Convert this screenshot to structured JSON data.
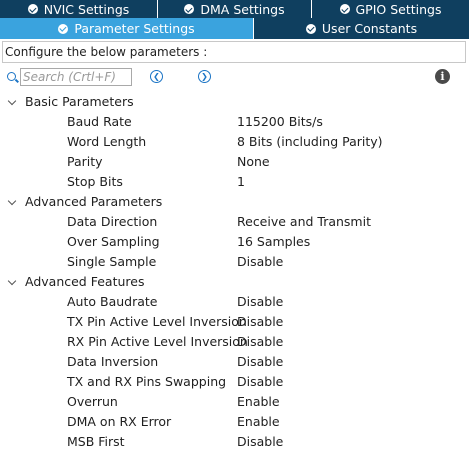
{
  "tabs": {
    "top": [
      {
        "label": "NVIC Settings"
      },
      {
        "label": "DMA Settings"
      },
      {
        "label": "GPIO Settings"
      }
    ],
    "bottom": [
      {
        "label": "Parameter Settings"
      },
      {
        "label": "User Constants"
      }
    ]
  },
  "configure_text": "Configure the below parameters :",
  "search": {
    "placeholder": "Search (Crtl+F)"
  },
  "colors": {
    "tab_dark": "#0f3f5f",
    "tab_active": "#3aa3de",
    "accent_blue": "#1b74c5"
  },
  "groups": [
    {
      "label": "Basic Parameters",
      "params": [
        {
          "name": "Baud Rate",
          "value": "115200 Bits/s"
        },
        {
          "name": "Word Length",
          "value": "8 Bits (including Parity)"
        },
        {
          "name": "Parity",
          "value": "None"
        },
        {
          "name": "Stop Bits",
          "value": "1"
        }
      ]
    },
    {
      "label": "Advanced Parameters",
      "params": [
        {
          "name": "Data Direction",
          "value": "Receive and Transmit"
        },
        {
          "name": "Over Sampling",
          "value": "16 Samples"
        },
        {
          "name": "Single Sample",
          "value": "Disable"
        }
      ]
    },
    {
      "label": "Advanced Features",
      "params": [
        {
          "name": "Auto Baudrate",
          "value": "Disable"
        },
        {
          "name": "TX Pin Active Level Inversion",
          "value": "Disable"
        },
        {
          "name": "RX Pin Active Level Inversion",
          "value": "Disable"
        },
        {
          "name": "Data Inversion",
          "value": "Disable"
        },
        {
          "name": "TX and RX Pins Swapping",
          "value": "Disable"
        },
        {
          "name": "Overrun",
          "value": "Enable"
        },
        {
          "name": "DMA on RX Error",
          "value": "Enable"
        },
        {
          "name": "MSB First",
          "value": "Disable"
        }
      ]
    }
  ]
}
